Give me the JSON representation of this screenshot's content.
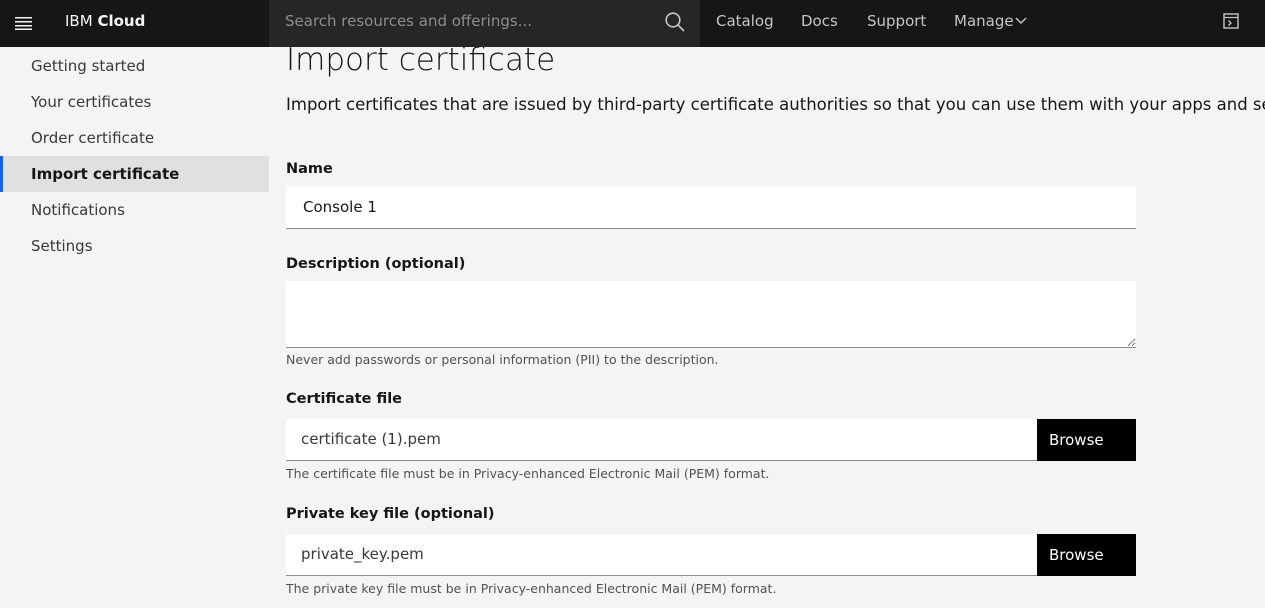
{
  "header": {
    "brand_prefix": "IBM",
    "brand_name": "Cloud",
    "search_placeholder": "Search resources and offerings...",
    "nav": [
      "Catalog",
      "Docs",
      "Support",
      "Manage"
    ]
  },
  "sidebar": {
    "items": [
      {
        "label": "Getting started",
        "active": false
      },
      {
        "label": "Your certificates",
        "active": false
      },
      {
        "label": "Order certificate",
        "active": false
      },
      {
        "label": "Import certificate",
        "active": true
      },
      {
        "label": "Notifications",
        "active": false
      },
      {
        "label": "Settings",
        "active": false
      }
    ]
  },
  "page": {
    "title": "Import certificate",
    "description": "Import certificates that are issued by third-party certificate authorities so that you can use them with your apps and services."
  },
  "form": {
    "name_label": "Name",
    "name_value": "Console 1",
    "description_label": "Description (optional)",
    "description_value": "",
    "description_helper": "Never add passwords or personal information (PII) to the description.",
    "cert_label": "Certificate file",
    "cert_file": "certificate (1).pem",
    "cert_browse": "Browse",
    "cert_helper": "The certificate file must be in Privacy-enhanced Electronic Mail (PEM) format.",
    "key_label": "Private key file (optional)",
    "key_file": "private_key.pem",
    "key_browse": "Browse",
    "key_helper": "The private key file must be in Privacy-enhanced Electronic Mail (PEM) format."
  },
  "colors": {
    "header_bg": "#161616",
    "search_bg": "#262626",
    "accent": "#0f62fe",
    "page_bg": "#f4f4f4"
  }
}
